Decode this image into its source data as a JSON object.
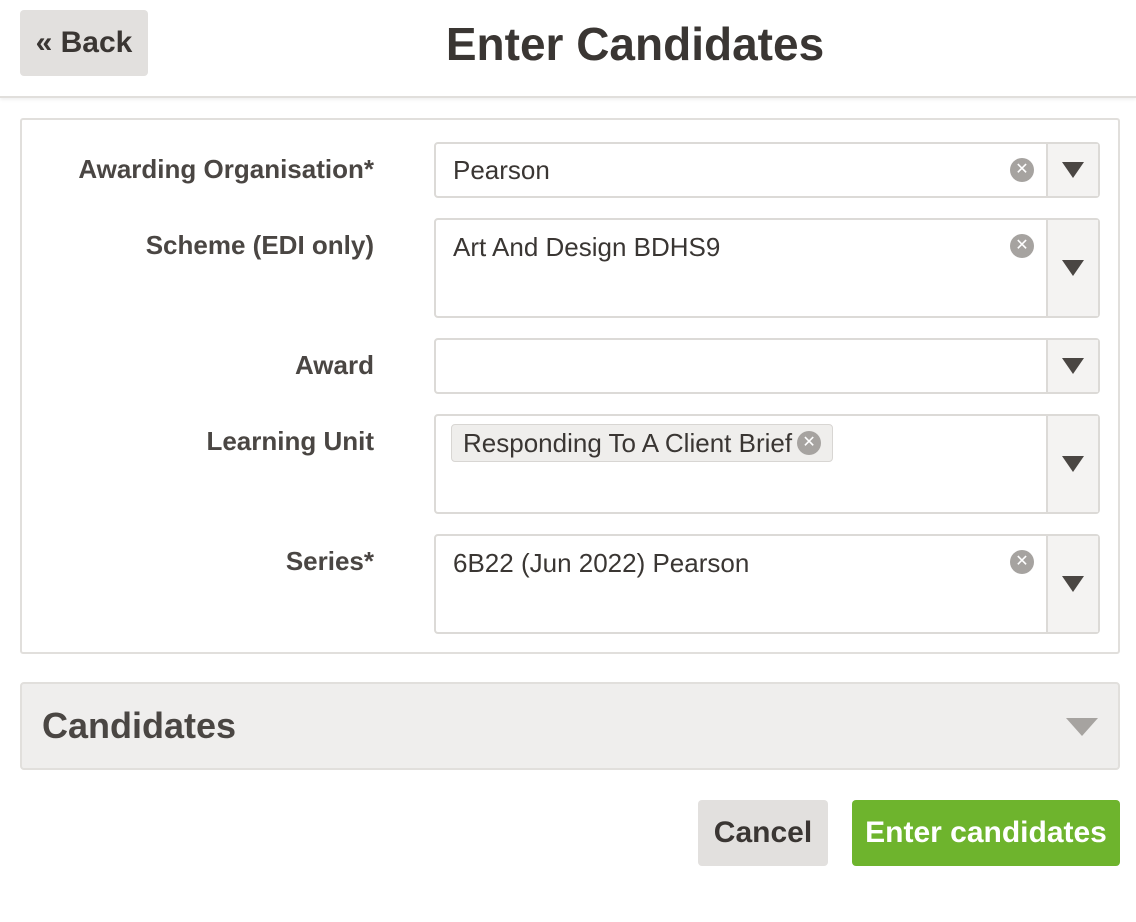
{
  "header": {
    "back_label": "« Back",
    "title": "Enter Candidates"
  },
  "form": {
    "awarding_organisation": {
      "label": "Awarding Organisation*",
      "value": "Pearson"
    },
    "scheme": {
      "label": "Scheme (EDI only)",
      "value": "Art And Design BDHS9"
    },
    "award": {
      "label": "Award",
      "value": ""
    },
    "learning_unit": {
      "label": "Learning Unit",
      "tags": [
        "Responding To A Client Brief"
      ]
    },
    "series": {
      "label": "Series*",
      "value": "6B22 (Jun 2022) Pearson"
    }
  },
  "candidates": {
    "title": "Candidates"
  },
  "actions": {
    "cancel_label": "Cancel",
    "submit_label": "Enter candidates"
  },
  "colors": {
    "primary_button": "#6eb42d",
    "secondary_button": "#e2e0de",
    "text": "#3a3633"
  }
}
